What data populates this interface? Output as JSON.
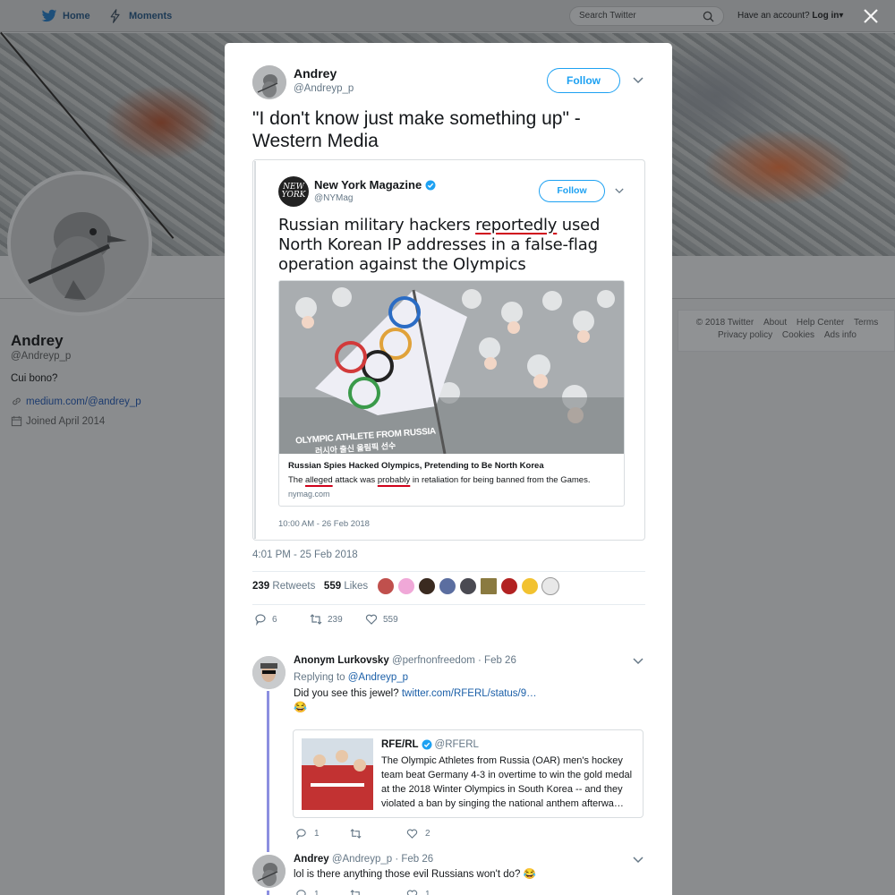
{
  "topnav": {
    "home_label": "Home",
    "moments_label": "Moments",
    "search_placeholder": "Search Twitter",
    "account_prompt": "Have an account?",
    "login_label": "Log in"
  },
  "profile": {
    "name": "Andrey",
    "handle": "@Andreyp_p",
    "bio": "Cui bono?",
    "link": "medium.com/@andrey_p",
    "joined": "Joined April 2014"
  },
  "footer": {
    "row1": [
      "© 2018 Twitter",
      "About",
      "Help Center",
      "Terms"
    ],
    "row2": [
      "Privacy policy",
      "Cookies",
      "Ads info"
    ]
  },
  "tweet": {
    "author_name": "Andrey",
    "author_handle": "@Andreyp_p",
    "follow_label": "Follow",
    "text": "\"I don't know just make something up\" - Western Media",
    "timestamp": "4:01 PM - 25 Feb 2018",
    "retweets": "239",
    "retweets_label": "Retweets",
    "likes": "559",
    "likes_label": "Likes",
    "reply_count": "6",
    "retweet_count": "239",
    "like_count": "559"
  },
  "quoted": {
    "avatar_text": "NEW YORK",
    "name": "New York Magazine",
    "handle": "@NYMag",
    "follow_label": "Follow",
    "text_before": "Russian military hackers ",
    "text_underlined": "reportedly",
    "text_after": " used North Korean IP addresses in a false-flag operation against the Olympics",
    "image_caption": "OLYMPIC ATHLETE FROM RUSSIA",
    "image_caption_ko": "러시아 출신 올림픽 선수",
    "card_title": "Russian Spies Hacked Olympics, Pretending to Be North Korea",
    "card_desc_1": "The ",
    "card_desc_u1": "alleged",
    "card_desc_2": " attack was ",
    "card_desc_u2": "probably",
    "card_desc_3": " in retaliation for being banned from the Games.",
    "card_domain": "nymag.com",
    "timestamp": "10:00 AM - 26 Feb 2018"
  },
  "replies": [
    {
      "name": "Anonym Lurkovsky",
      "handle": "@perfnonfreedom",
      "date": "· Feb 26",
      "replying_to_label": "Replying to",
      "replying_to": "@Andreyp_p",
      "text": "Did you see this jewel?",
      "link": "twitter.com/RFERL/status/9…",
      "emoji": "😂",
      "card_name": "RFE/RL",
      "card_handle": "@RFERL",
      "card_text": "The Olympic Athletes from Russia (OAR) men's hockey team beat Germany 4-3 in overtime to win the gold medal at the 2018 Winter Olympics in South Korea -- and they violated a ban by singing the national anthem afterwa…",
      "reply_count": "1",
      "retweet_count": "",
      "like_count": "2"
    },
    {
      "name": "Andrey",
      "handle": "@Andreyp_p",
      "date": "· Feb 26",
      "text": "lol is there anything those evil Russians won't do? 😂",
      "reply_count": "1",
      "retweet_count": "",
      "like_count": "1"
    }
  ],
  "colors": {
    "accent": "#1da1f2",
    "link": "#1b5fa8",
    "underline": "#d0021b",
    "thread_line": "#8c8fe0"
  }
}
